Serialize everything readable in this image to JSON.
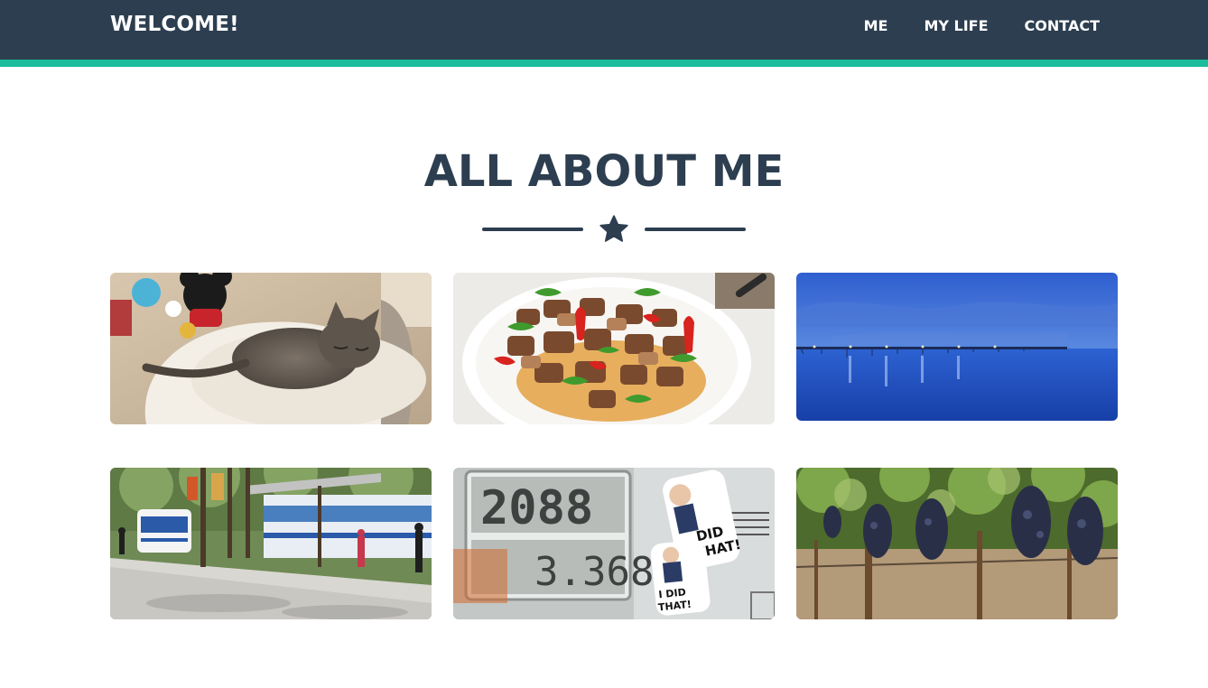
{
  "navbar": {
    "brand": "WELCOME!",
    "links": [
      "ME",
      "MY LIFE",
      "CONTACT"
    ],
    "background": "#2c3e50",
    "accent": "#1abc9c"
  },
  "section": {
    "title": "ALL ABOUT ME",
    "divider_icon": "star-icon"
  },
  "portfolio": [
    {
      "subject": "kitten-photo"
    },
    {
      "subject": "food-dish-photo"
    },
    {
      "subject": "bridge-at-dusk-photo"
    },
    {
      "subject": "street-tram-photo"
    },
    {
      "subject": "gas-pump-display-photo",
      "stickers": [
        "DID THAT!",
        "I DID THAT!"
      ]
    },
    {
      "subject": "vineyard-grapes-photo"
    }
  ],
  "colors": {
    "primary": "#2c3e50",
    "secondary": "#1abc9c",
    "background": "#ffffff"
  }
}
